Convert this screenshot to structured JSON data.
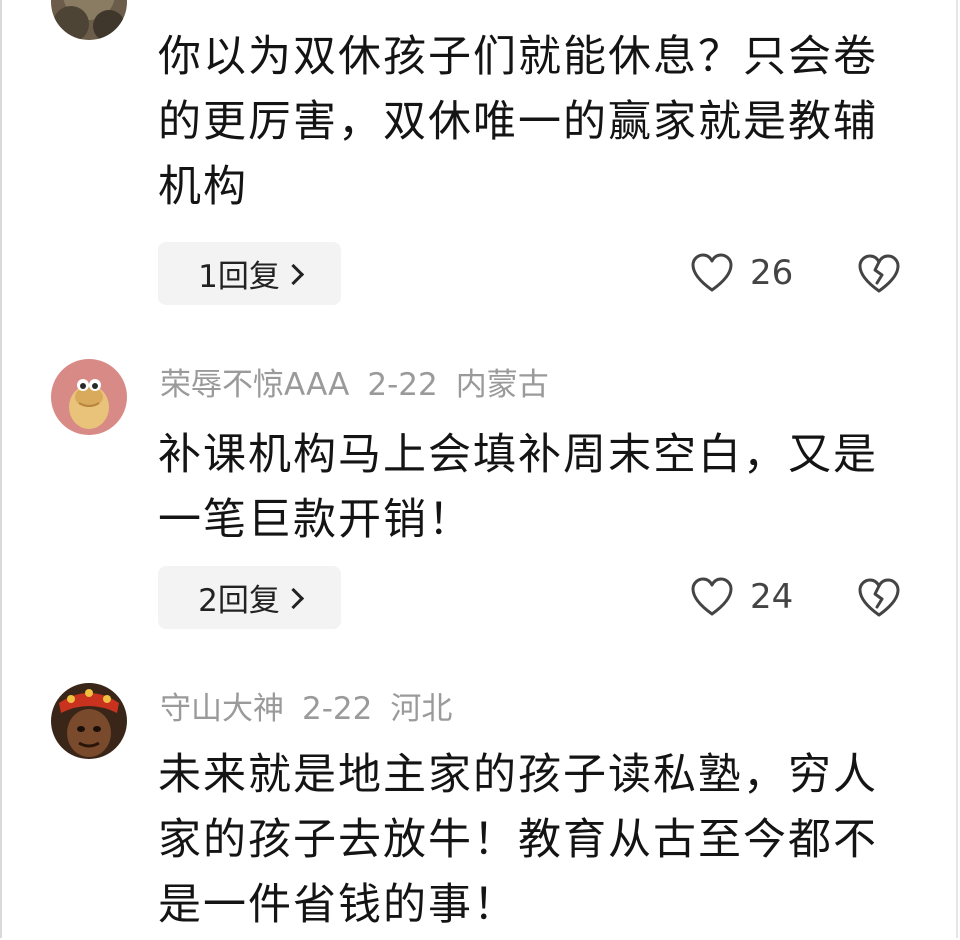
{
  "comments": [
    {
      "username": "",
      "date": "",
      "location": "",
      "text": "你以为双休孩子们就能休息？只会卷的更厉害，双休唯一的赢家就是教辅机构",
      "reply_label": "1回复",
      "likes": "26"
    },
    {
      "username": "荣辱不惊AAA",
      "date": "2-22",
      "location": "内蒙古",
      "text": "补课机构马上会填补周末空白，又是一笔巨款开销！",
      "reply_label": "2回复",
      "likes": "24"
    },
    {
      "username": "守山大神",
      "date": "2-22",
      "location": "河北",
      "text": "未来就是地主家的孩子读私塾，穷人家的孩子去放牛！教育从古至今都不是一件省钱的事！"
    }
  ],
  "icons": {
    "like": "heart-outline-icon",
    "dislike": "broken-heart-icon",
    "reply_arrow": "chevron-right-icon"
  }
}
